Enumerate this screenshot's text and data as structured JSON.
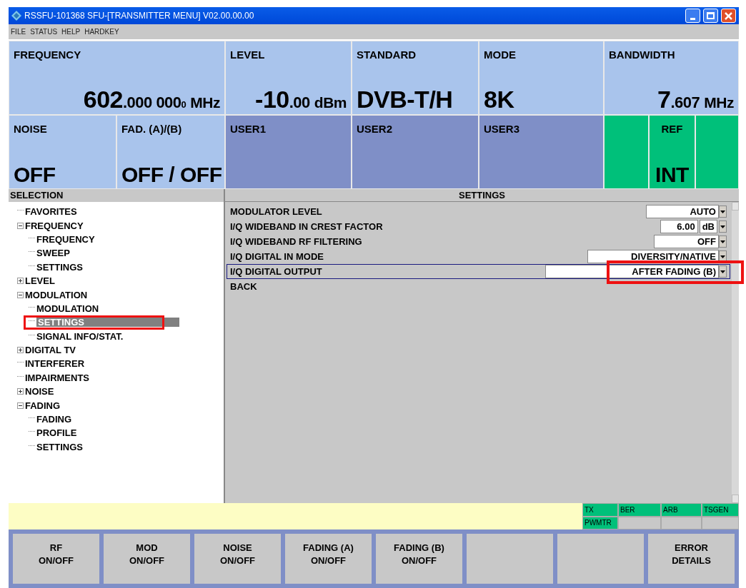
{
  "window": {
    "title": "RSSFU-101368  SFU-[TRANSMITTER MENU]  V02.00.00.00"
  },
  "menu": [
    "FILE",
    "STATUS",
    "HELP",
    "HARDKEY"
  ],
  "top_panels": [
    {
      "kind": "param",
      "label": "FREQUENCY",
      "value": {
        "integer": "602",
        "fraction": ".000 000",
        "digit": "0",
        "unit": "MHz"
      }
    },
    {
      "kind": "param",
      "label": "LEVEL",
      "value": {
        "integer": "-10",
        "fraction": ".00",
        "unit": "dBm"
      }
    },
    {
      "kind": "param",
      "label": "STANDARD",
      "value": {
        "integer": "DVB-T/H"
      }
    },
    {
      "kind": "param",
      "label": "MODE",
      "value": {
        "integer": "8K"
      }
    },
    {
      "kind": "param",
      "label": "BANDWIDTH",
      "value": {
        "integer": "7",
        "fraction": ".607",
        "unit": "MHz"
      }
    }
  ],
  "status_panels": [
    {
      "kind": "param",
      "label": "NOISE",
      "value": "OFF"
    },
    {
      "kind": "param",
      "label": "FAD. (A)/(B)",
      "value": "OFF / OFF"
    },
    {
      "kind": "user",
      "label": "USER1"
    },
    {
      "kind": "user",
      "label": "USER2"
    },
    {
      "kind": "user",
      "label": "USER3"
    },
    {
      "kind": "indicator"
    },
    {
      "kind": "indicator",
      "label": "REF",
      "value": "INT"
    },
    {
      "kind": "indicator"
    }
  ],
  "selection": {
    "title": "SELECTION",
    "tree": [
      {
        "kind": "leaf",
        "label": "FAVORITES",
        "selected": false,
        "highlighted": false
      },
      {
        "kind": "folder",
        "label": "FREQUENCY",
        "expanded": true,
        "selected": false,
        "highlighted": false,
        "children": [
          {
            "kind": "leaf",
            "label": "FREQUENCY",
            "selected": false,
            "highlighted": false
          },
          {
            "kind": "leaf",
            "label": "SWEEP",
            "selected": false,
            "highlighted": false
          },
          {
            "kind": "leaf",
            "label": "SETTINGS",
            "selected": false,
            "highlighted": false
          }
        ]
      },
      {
        "kind": "folder",
        "label": "LEVEL",
        "expanded": false,
        "selected": false,
        "highlighted": false
      },
      {
        "kind": "folder",
        "label": "MODULATION",
        "expanded": true,
        "selected": false,
        "highlighted": false,
        "children": [
          {
            "kind": "leaf",
            "label": "MODULATION",
            "selected": false,
            "highlighted": false
          },
          {
            "kind": "leaf",
            "label": "SETTINGS",
            "selected": true,
            "highlighted": true
          },
          {
            "kind": "leaf",
            "label": "SIGNAL INFO/STAT.",
            "selected": false,
            "highlighted": false
          }
        ]
      },
      {
        "kind": "folder",
        "label": "DIGITAL TV",
        "expanded": false,
        "selected": false,
        "highlighted": false
      },
      {
        "kind": "leaf",
        "label": "INTERFERER",
        "selected": false,
        "highlighted": false
      },
      {
        "kind": "leaf",
        "label": "IMPAIRMENTS",
        "selected": false,
        "highlighted": false
      },
      {
        "kind": "folder",
        "label": "NOISE",
        "expanded": false,
        "selected": false,
        "highlighted": false
      },
      {
        "kind": "folder",
        "label": "FADING",
        "expanded": true,
        "selected": false,
        "highlighted": false,
        "children": [
          {
            "kind": "leaf",
            "label": "FADING",
            "selected": false,
            "highlighted": false
          },
          {
            "kind": "leaf",
            "label": "PROFILE",
            "selected": false,
            "highlighted": false
          },
          {
            "kind": "leaf",
            "label": "SETTINGS",
            "selected": false,
            "highlighted": false
          }
        ]
      }
    ]
  },
  "settings": {
    "title": "SETTINGS",
    "rows": [
      {
        "kind": "dropdown",
        "label": "MODULATOR LEVEL",
        "value": "AUTO",
        "selected": false,
        "highlighted": false
      },
      {
        "kind": "number",
        "label": "I/Q WIDEBAND IN CREST FACTOR",
        "value": "6.00",
        "unit": "dB",
        "selected": false,
        "highlighted": false
      },
      {
        "kind": "dropdown",
        "label": "I/Q WIDEBAND RF FILTERING",
        "value": "OFF",
        "selected": false,
        "highlighted": false
      },
      {
        "kind": "dropdown",
        "label": "I/Q DIGITAL IN MODE",
        "value": "DIVERSITY/NATIVE",
        "selected": false,
        "highlighted": false
      },
      {
        "kind": "dropdown",
        "label": "I/Q DIGITAL OUTPUT",
        "value": "AFTER FADING (B)",
        "selected": true,
        "highlighted": true
      },
      {
        "kind": "link",
        "label": "BACK",
        "selected": false,
        "highlighted": false
      }
    ]
  },
  "status_cells": [
    {
      "name": "TX",
      "on": true
    },
    {
      "name": "BER",
      "on": true
    },
    {
      "name": "ARB",
      "on": true
    },
    {
      "name": "TSGEN",
      "on": true
    },
    {
      "name": "PWMTR",
      "on": true
    },
    {
      "on": false
    },
    {
      "on": false
    },
    {
      "on": false
    }
  ],
  "softkeys": [
    {
      "kind": "labeled",
      "lines": [
        "RF",
        "ON/OFF"
      ]
    },
    {
      "kind": "labeled",
      "lines": [
        "MOD",
        "ON/OFF"
      ]
    },
    {
      "kind": "labeled",
      "lines": [
        "NOISE",
        "ON/OFF"
      ]
    },
    {
      "kind": "labeled",
      "lines": [
        "FADING (A)",
        "ON/OFF"
      ]
    },
    {
      "kind": "labeled",
      "lines": [
        "FADING (B)",
        "ON/OFF"
      ]
    },
    {
      "kind": "blank"
    },
    {
      "kind": "blank"
    },
    {
      "kind": "labeled",
      "lines": [
        "ERROR",
        "DETAILS"
      ]
    }
  ]
}
